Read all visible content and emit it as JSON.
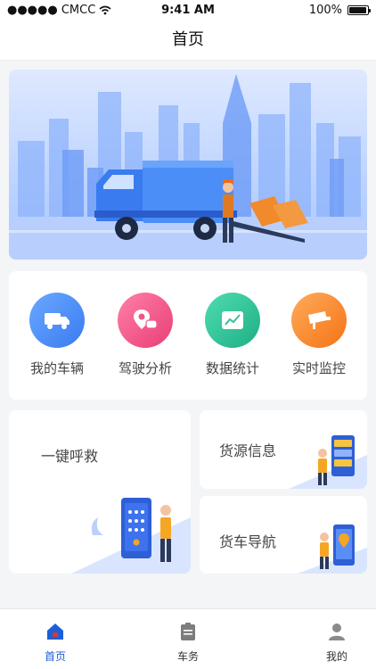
{
  "status_bar": {
    "carrier": "●●●●● CMCC",
    "time": "9:41 AM",
    "battery": "100%"
  },
  "nav": {
    "title": "首页"
  },
  "quick_actions": [
    {
      "label": "我的车辆",
      "icon": "truck-icon",
      "color": "#4a8df8"
    },
    {
      "label": "驾驶分析",
      "icon": "location-chat-icon",
      "color": "#f0568a"
    },
    {
      "label": "数据统计",
      "icon": "chart-icon",
      "color": "#2fc49a"
    },
    {
      "label": "实时监控",
      "icon": "camera-icon",
      "color": "#ff8a2a"
    }
  ],
  "features": {
    "rescue": "一键呼救",
    "cargo": "货源信息",
    "navigation": "货车导航"
  },
  "tabs": [
    {
      "label": "首页",
      "icon": "home-icon",
      "active": true
    },
    {
      "label": "车务",
      "icon": "clipboard-icon",
      "active": false
    },
    {
      "label": "我的",
      "icon": "user-icon",
      "active": false
    }
  ],
  "colors": {
    "accent": "#1d5fd6"
  }
}
